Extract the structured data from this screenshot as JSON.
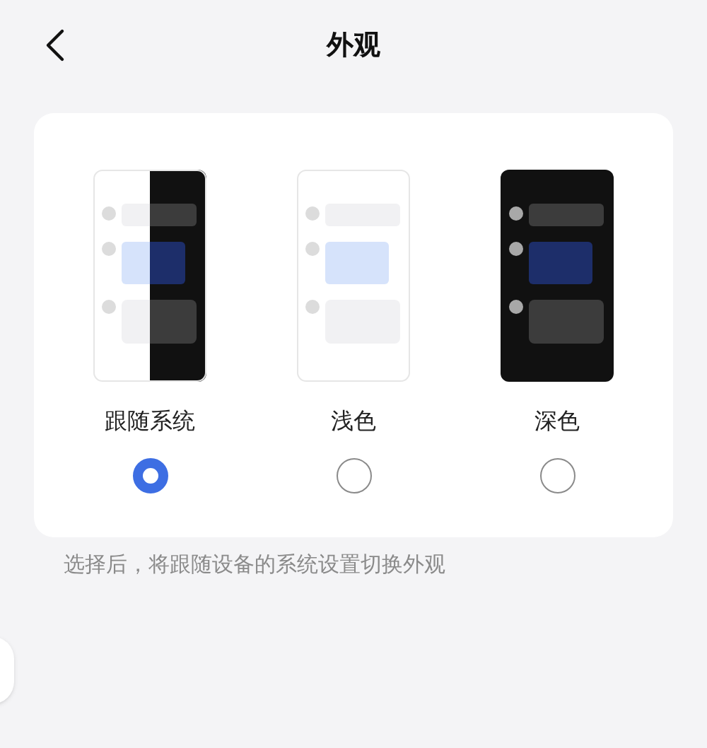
{
  "header": {
    "title": "外观"
  },
  "options": [
    {
      "kind": "system",
      "label": "跟随系统",
      "selected": true
    },
    {
      "kind": "light",
      "label": "浅色",
      "selected": false
    },
    {
      "kind": "dark",
      "label": "深色",
      "selected": false
    }
  ],
  "hint": "选择后，将跟随设备的系统设置切换外观"
}
